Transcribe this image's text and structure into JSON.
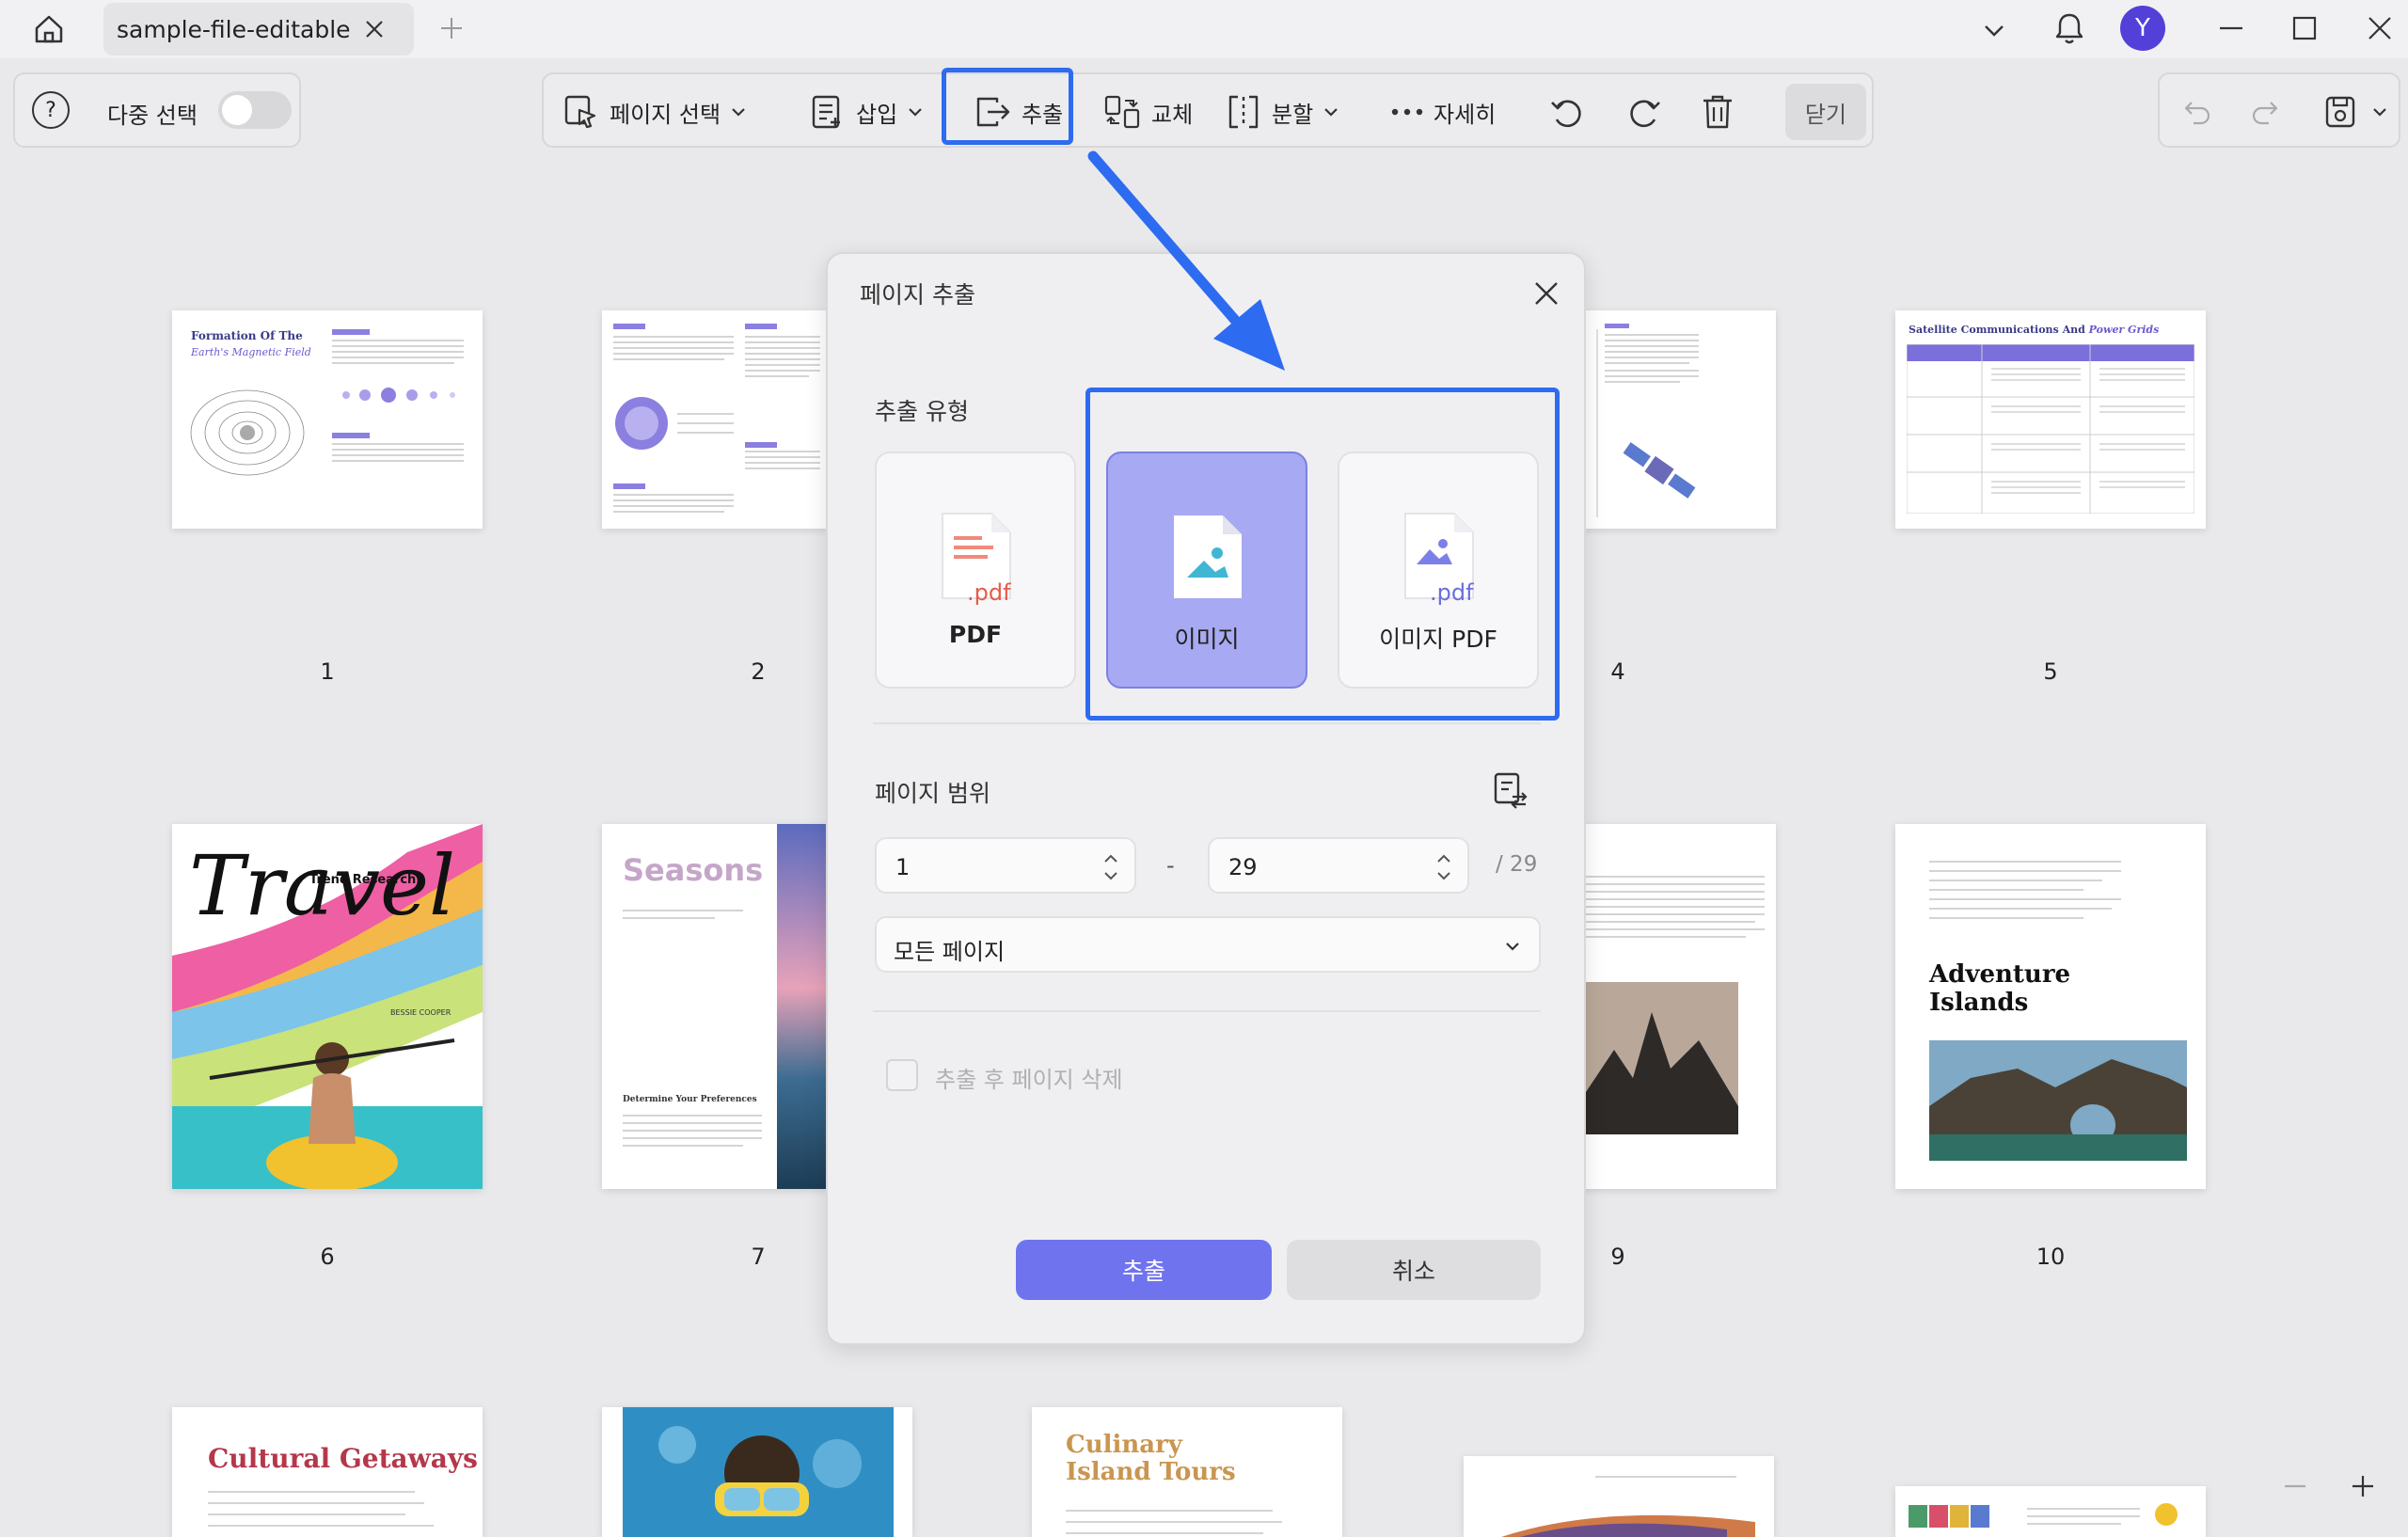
{
  "tab": {
    "title": "sample-file-editable"
  },
  "titlebar": {
    "avatar_letter": "Y"
  },
  "toolbar_left": {
    "help": "?",
    "multi_select_label": "다중 선택"
  },
  "toolbar": {
    "select_page": "페이지 선택",
    "insert": "삽입",
    "extract": "추출",
    "replace": "교체",
    "split": "분할",
    "more": "자세히",
    "close": "닫기"
  },
  "accent_color": "#3b6cf0",
  "dialog": {
    "title": "페이지 추출",
    "extract_type_label": "추출 유형",
    "options": [
      {
        "label": "PDF",
        "icon_text": ".pdf"
      },
      {
        "label": "이미지",
        "selected": true
      },
      {
        "label": "이미지 PDF",
        "icon_text": ".pdf"
      }
    ],
    "page_range_label": "페이지 범위",
    "range_from": "1",
    "range_separator": "-",
    "range_to": "29",
    "range_total": "/ 29",
    "range_mode": "모든 페이지",
    "delete_after": "추출 후 페이지 삭제",
    "extract_button": "추출",
    "cancel_button": "취소"
  },
  "pages": [
    {
      "num": "1",
      "title": "Formation Of The",
      "subtitle": "Earth's Magnetic Field"
    },
    {
      "num": "2"
    },
    {
      "num": "4"
    },
    {
      "num": "5",
      "title": "Satellite Communications And",
      "title_em": "Power Grids"
    },
    {
      "num": "6",
      "title": "Travel",
      "tag": "Trend Research",
      "author": "BESSIE COOPER"
    },
    {
      "num": "7",
      "title": "Seasons",
      "heading": "Determine Your Preferences"
    },
    {
      "num": "9"
    },
    {
      "num": "10",
      "title": "Adventure Islands"
    },
    {
      "title": "Cultural Getaways"
    },
    {
      "title": "Culinary Island Tours"
    }
  ]
}
